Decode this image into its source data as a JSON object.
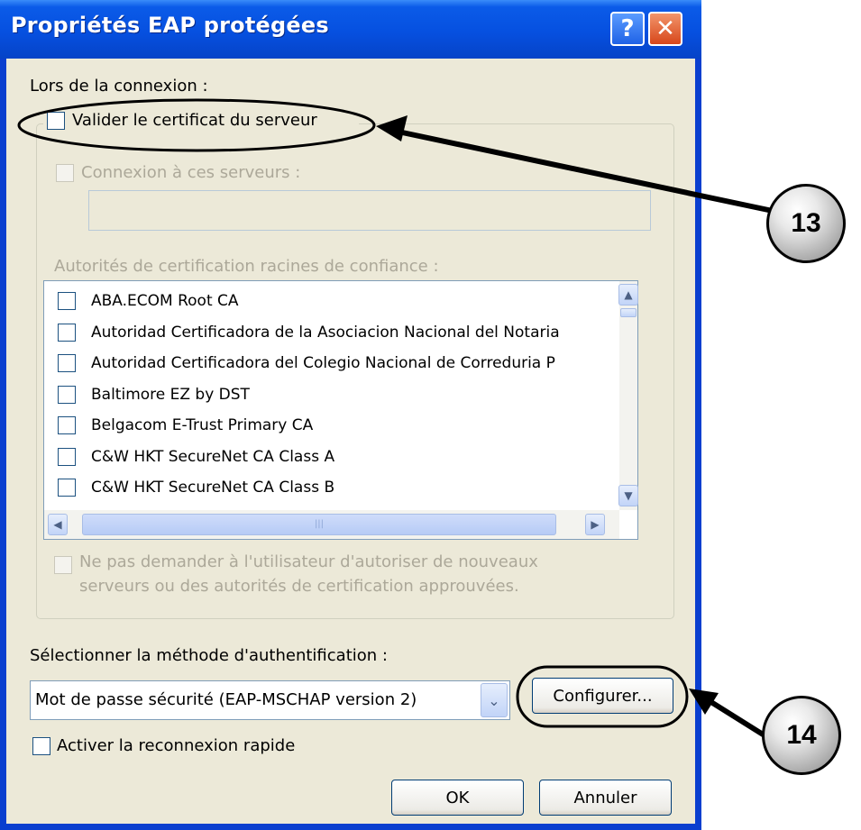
{
  "window": {
    "title": "Propriétés EAP protégées",
    "help_glyph": "?",
    "close_glyph": "✕"
  },
  "connection_section": {
    "heading": "Lors de la connexion :",
    "validate_cert_label": "Valider le certificat du serveur",
    "validate_cert_checked": false,
    "connect_servers_label": "Connexion à ces serveurs :",
    "servers_value": "",
    "trusted_roots_label": "Autorités de certification racines de confiance :",
    "ca_list": [
      {
        "label": "ABA.ECOM Root CA",
        "checked": false
      },
      {
        "label": "Autoridad Certificadora de la Asociacion Nacional del Notaria",
        "checked": false
      },
      {
        "label": "Autoridad Certificadora del Colegio Nacional de Correduria P",
        "checked": false
      },
      {
        "label": "Baltimore EZ by DST",
        "checked": false
      },
      {
        "label": "Belgacom E-Trust Primary CA",
        "checked": false
      },
      {
        "label": "C&W HKT SecureNet CA Class A",
        "checked": false
      },
      {
        "label": "C&W HKT SecureNet CA Class B",
        "checked": false
      }
    ],
    "no_prompt_label_line1": "Ne pas demander à l'utilisateur d'autoriser de nouveaux",
    "no_prompt_label_line2": "serveurs ou des autorités de certification approuvées."
  },
  "auth": {
    "method_label": "Sélectionner la méthode d'authentification :",
    "selected_method": "Mot de passe sécurité (EAP-MSCHAP version 2)",
    "configure_label": "Configurer...",
    "fast_reconnect_label": "Activer la reconnexion rapide",
    "fast_reconnect_checked": false
  },
  "buttons": {
    "ok": "OK",
    "cancel": "Annuler"
  },
  "callouts": {
    "a": "13",
    "b": "14"
  },
  "colors": {
    "titlebar": "#0650e0",
    "dialog_bg": "#ece9d8",
    "close_button": "#d7461a",
    "disabled_text": "#aca899"
  }
}
